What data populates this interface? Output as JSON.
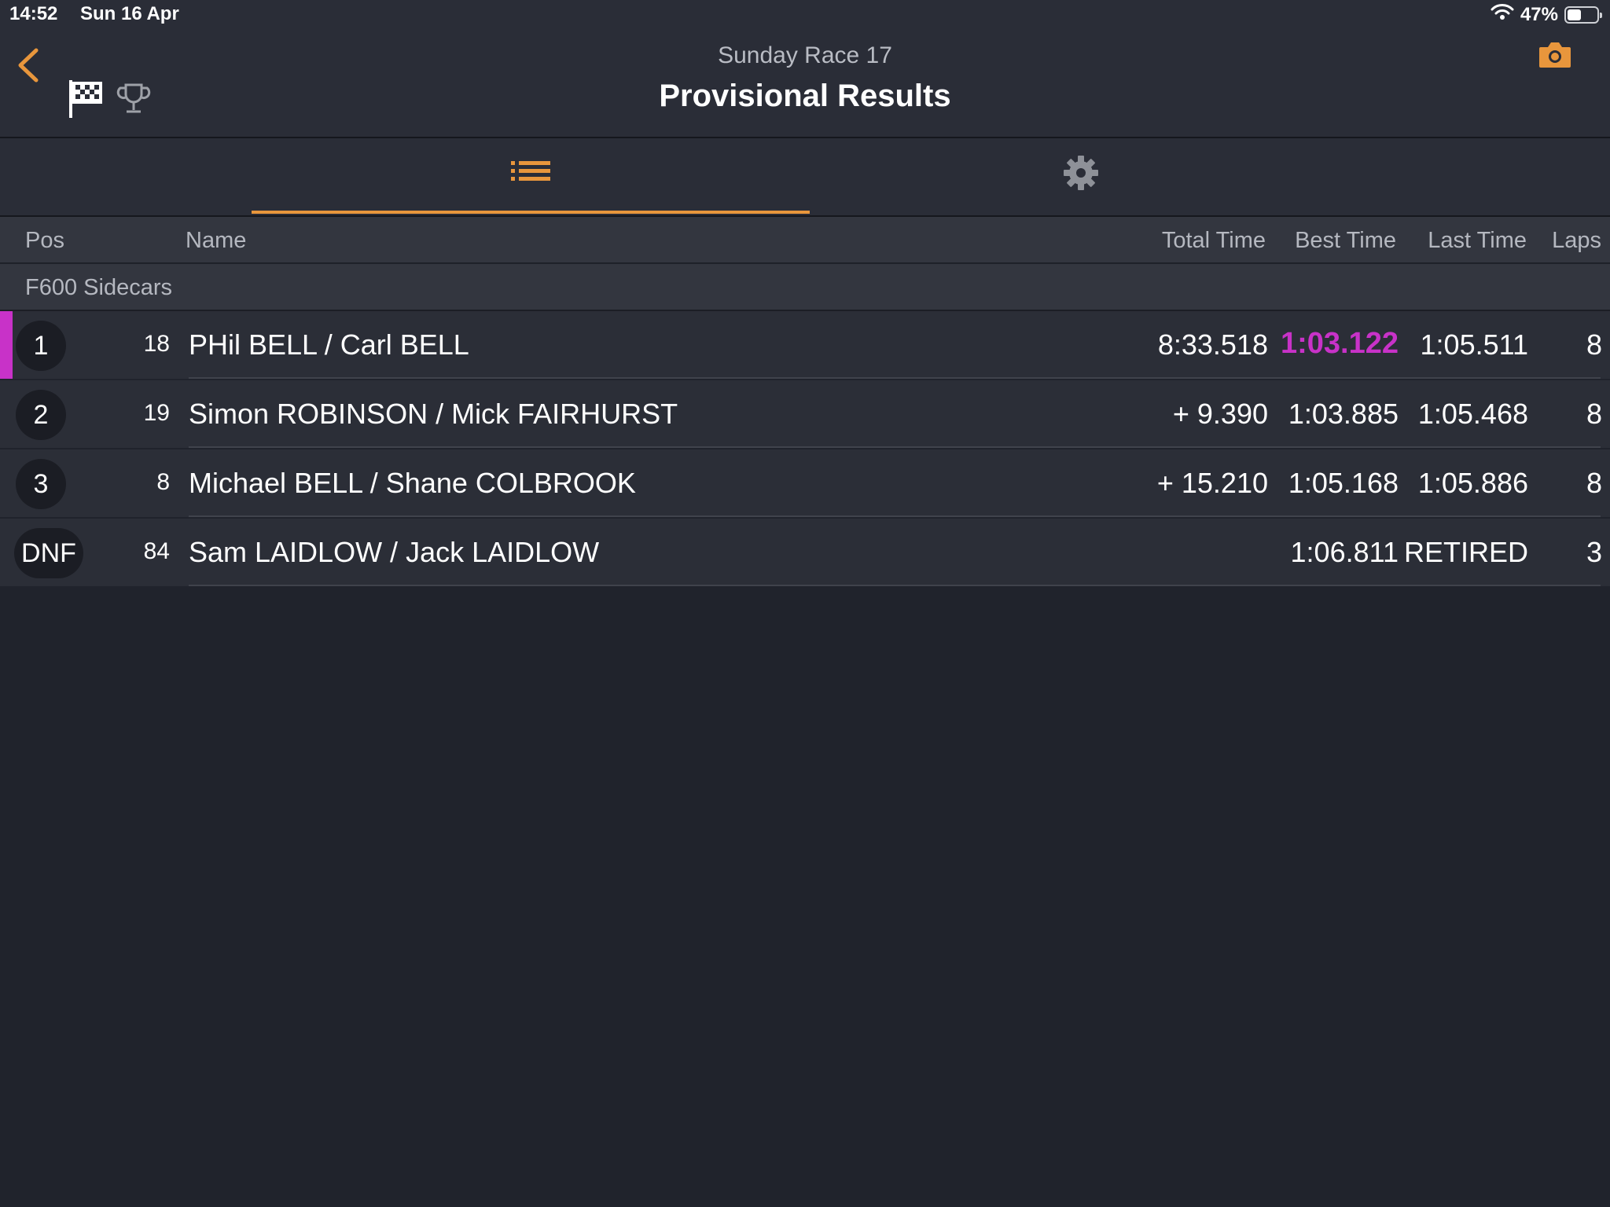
{
  "status_bar": {
    "time": "14:52",
    "date": "Sun 16 Apr",
    "battery": "47%",
    "battery_level": 0.47
  },
  "header": {
    "subtitle": "Sunday Race 17",
    "title": "Provisional Results",
    "back_icon": "chevron-left-icon",
    "icons": [
      "checkered-flag-icon",
      "trophy-icon",
      "camera-icon"
    ],
    "accent_color": "#e8963c"
  },
  "tabs": [
    {
      "icon": "list-icon",
      "active": true
    },
    {
      "icon": "gear-icon",
      "active": false
    }
  ],
  "columns": {
    "pos": "Pos",
    "name": "Name",
    "total_time": "Total Time",
    "best_time": "Best Time",
    "last_time": "Last Time",
    "laps": "Laps"
  },
  "group": "F600 Sidecars",
  "rows": [
    {
      "pos": "1",
      "number": "18",
      "name": "PHil BELL / Carl BELL",
      "total": "8:33.518",
      "best": "1:03.122",
      "last": "1:05.511",
      "laps": "8",
      "fastest": true
    },
    {
      "pos": "2",
      "number": "19",
      "name": "Simon ROBINSON / Mick FAIRHURST",
      "total": "+ 9.390",
      "best": "1:03.885",
      "last": "1:05.468",
      "laps": "8"
    },
    {
      "pos": "3",
      "number": "8",
      "name": "Michael BELL / Shane COLBROOK",
      "total": "+ 15.210",
      "best": "1:05.168",
      "last": "1:05.886",
      "laps": "8"
    },
    {
      "pos": "DNF",
      "number": "84",
      "name": "Sam LAIDLOW / Jack LAIDLOW",
      "total": "",
      "best": "1:06.811",
      "last": "RETIRED",
      "laps": "3"
    }
  ],
  "fastest_color": "#c832c8"
}
